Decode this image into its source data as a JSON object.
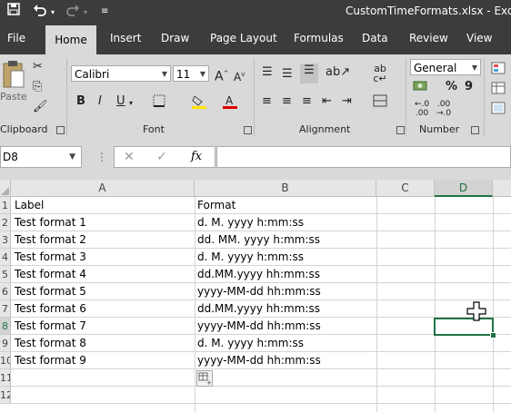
{
  "window": {
    "title": "CustomTimeFormats.xlsx  -  Excel"
  },
  "qat": {
    "save_icon": "save-icon",
    "undo_icon": "undo-icon",
    "redo_icon": "redo-icon"
  },
  "tabs": [
    {
      "label": "File"
    },
    {
      "label": "Home",
      "active": true
    },
    {
      "label": "Insert"
    },
    {
      "label": "Draw"
    },
    {
      "label": "Page Layout"
    },
    {
      "label": "Formulas"
    },
    {
      "label": "Data"
    },
    {
      "label": "Review"
    },
    {
      "label": "View"
    }
  ],
  "ribbon": {
    "clipboard": {
      "label": "Clipboard",
      "paste_label": "Paste"
    },
    "font": {
      "label": "Font",
      "name": "Calibri",
      "size": "11",
      "bold": "B",
      "italic": "I",
      "underline": "U"
    },
    "alignment": {
      "label": "Alignment",
      "wrap_icon_text": "ab c"
    },
    "number": {
      "label": "Number",
      "format": "General",
      "percent": "%",
      "comma": "9"
    }
  },
  "formula_bar": {
    "name_box": "D8",
    "fx": "fx",
    "value": ""
  },
  "grid": {
    "columns": [
      "A",
      "B",
      "C",
      "D"
    ],
    "selected_column": "D",
    "row_numbers": [
      "1",
      "2",
      "3",
      "4",
      "5",
      "6",
      "7",
      "8",
      "9",
      "10",
      "11",
      "12"
    ],
    "selected_row": "8",
    "rows": [
      {
        "a": "Label",
        "b": "Format"
      },
      {
        "a": "Test format 1",
        "b": "d. M. yyyy h:mm:ss"
      },
      {
        "a": "Test format 2",
        "b": "dd. MM. yyyy h:mm:ss"
      },
      {
        "a": "Test format 3",
        "b": "d. M. yyyy h:mm:ss"
      },
      {
        "a": "Test format 4",
        "b": "dd.MM.yyyy hh:mm:ss"
      },
      {
        "a": "Test format 5",
        "b": "yyyy-MM-dd hh:mm:ss"
      },
      {
        "a": "Test format 6",
        "b": "dd.MM.yyyy hh:mm:ss"
      },
      {
        "a": "Test format 7",
        "b": "yyyy-MM-dd hh:mm:ss"
      },
      {
        "a": "Test format 8",
        "b": "d. M. yyyy h:mm:ss"
      },
      {
        "a": "Test format 9",
        "b": "yyyy-MM-dd hh:mm:ss"
      }
    ]
  },
  "colors": {
    "chrome": "#3c3c3c",
    "ribbon": "#d9d9d9",
    "accent": "#217346"
  }
}
